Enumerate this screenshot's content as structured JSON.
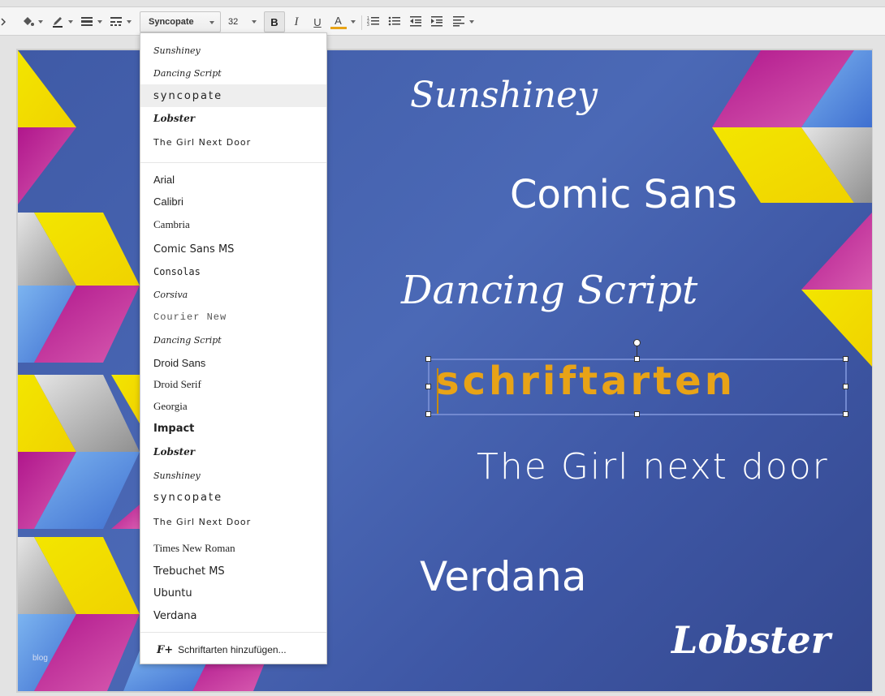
{
  "toolbar": {
    "font_name": "Syncopate",
    "font_size": "32",
    "bold_label": "B",
    "italic_label": "I",
    "underline_label": "U",
    "text_color_label": "A",
    "text_color": "#e8a317"
  },
  "font_menu": {
    "recent": [
      {
        "label": "Sunshiney"
      },
      {
        "label": "Dancing Script"
      },
      {
        "label": "Syncopate",
        "selected": true
      },
      {
        "label": "Lobster"
      },
      {
        "label": "The Girl Next Door"
      }
    ],
    "all": [
      {
        "label": "Arial"
      },
      {
        "label": "Calibri"
      },
      {
        "label": "Cambria"
      },
      {
        "label": "Comic Sans MS"
      },
      {
        "label": "Consolas"
      },
      {
        "label": "Corsiva"
      },
      {
        "label": "Courier New"
      },
      {
        "label": "Dancing Script"
      },
      {
        "label": "Droid Sans"
      },
      {
        "label": "Droid Serif"
      },
      {
        "label": "Georgia"
      },
      {
        "label": "Impact"
      },
      {
        "label": "Lobster"
      },
      {
        "label": "Sunshiney"
      },
      {
        "label": "Syncopate"
      },
      {
        "label": "The Girl Next Door"
      },
      {
        "label": "Times New Roman"
      },
      {
        "label": "Trebuchet MS"
      },
      {
        "label": "Ubuntu"
      },
      {
        "label": "Verdana"
      }
    ],
    "add_fonts_label": "Schriftarten hinzufügen..."
  },
  "slide": {
    "texts": {
      "sunshiney": "Sunshiney",
      "comic_sans": "Comic Sans",
      "dancing_script": "Dancing Script",
      "schriftarten": "schriftarten",
      "girl_next_door": "The Girl next door",
      "verdana": "Verdana",
      "lobster": "Lobster"
    },
    "watermark": "blog"
  },
  "colors": {
    "slide_bg": "#4560ad",
    "accent_orange": "#e8a317",
    "selection": "#7289d0"
  }
}
